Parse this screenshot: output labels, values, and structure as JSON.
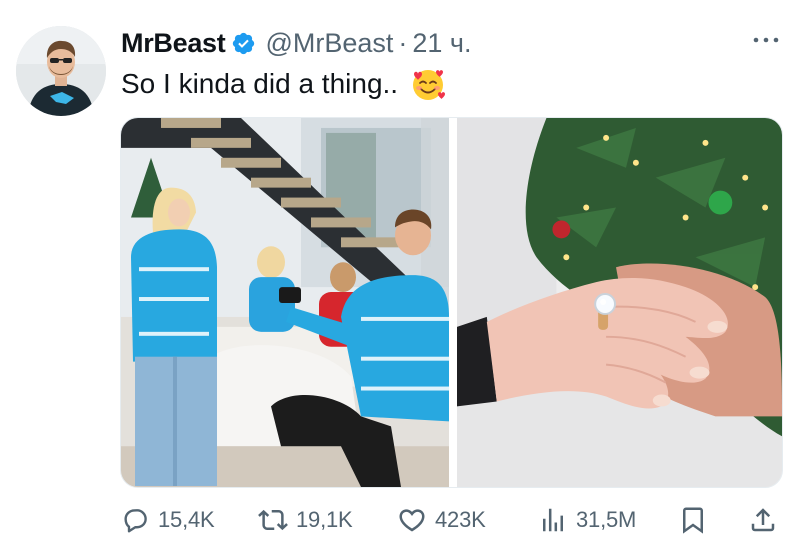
{
  "author": {
    "display_name": "MrBeast",
    "handle": "@MrBeast",
    "separator": "·",
    "time": "21 ч.",
    "verified": true,
    "avatar_icon": "profile-photo"
  },
  "tweet": {
    "text": "So I kinda did a thing..",
    "emoji_icon": "smiling-face-with-hearts-emoji"
  },
  "media": [
    {
      "icon": "photo-proposal-kneeling-family-ugly-sweaters"
    },
    {
      "icon": "photo-engagement-ring-hands-christmas-tree"
    }
  ],
  "actions": {
    "replies": "15,4K",
    "reposts": "19,1K",
    "likes": "423K",
    "views": "31,5M"
  },
  "colors": {
    "text": "#0f1419",
    "secondary": "#536471",
    "verified": "#1d9bf0",
    "sweater_blue": "#28a8e0"
  }
}
